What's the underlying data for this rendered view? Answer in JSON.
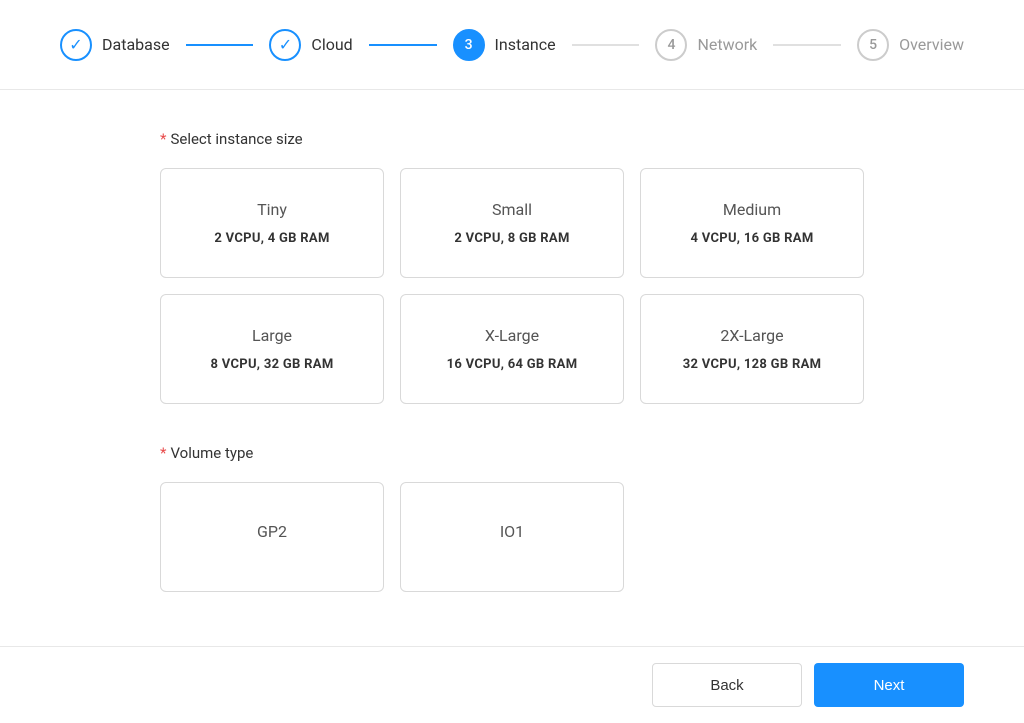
{
  "stepper": {
    "steps": [
      {
        "id": "database",
        "label": "Database",
        "number": "1",
        "state": "completed"
      },
      {
        "id": "cloud",
        "label": "Cloud",
        "number": "2",
        "state": "completed"
      },
      {
        "id": "instance",
        "label": "Instance",
        "number": "3",
        "state": "active"
      },
      {
        "id": "network",
        "label": "Network",
        "number": "4",
        "state": "inactive"
      },
      {
        "id": "overview",
        "label": "Overview",
        "number": "5",
        "state": "inactive"
      }
    ]
  },
  "instance_section": {
    "label": "Select instance size",
    "cards": [
      {
        "id": "tiny",
        "title": "Tiny",
        "spec": "2 VCPU, 4 GB RAM"
      },
      {
        "id": "small",
        "title": "Small",
        "spec": "2 VCPU, 8 GB RAM"
      },
      {
        "id": "medium",
        "title": "Medium",
        "spec": "4 VCPU, 16 GB RAM"
      },
      {
        "id": "large",
        "title": "Large",
        "spec": "8 VCPU, 32 GB RAM"
      },
      {
        "id": "xlarge",
        "title": "X-Large",
        "spec": "16 VCPU, 64 GB RAM"
      },
      {
        "id": "2xlarge",
        "title": "2X-Large",
        "spec": "32 VCPU, 128 GB RAM"
      }
    ]
  },
  "volume_section": {
    "label": "Volume type",
    "cards": [
      {
        "id": "gp2",
        "title": "GP2"
      },
      {
        "id": "io1",
        "title": "IO1"
      }
    ]
  },
  "footer": {
    "back_label": "Back",
    "next_label": "Next"
  }
}
